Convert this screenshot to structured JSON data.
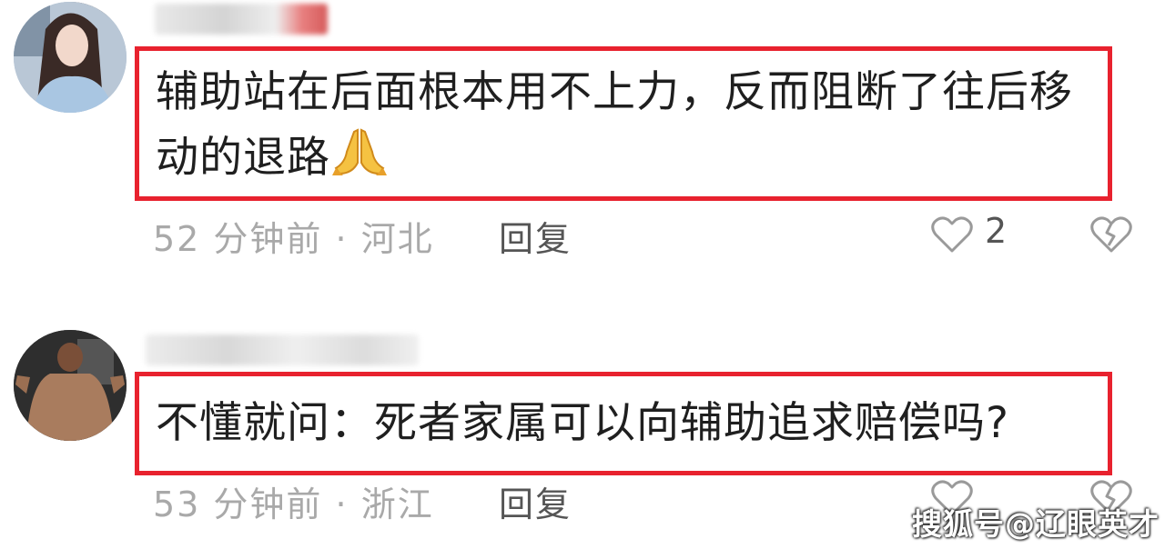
{
  "comments": [
    {
      "text": "辅助站在后面根本用不上力，反而阻断了往后移动的退路",
      "emoji": "🙏",
      "time": "52 分钟前",
      "separator": "·",
      "location": "河北",
      "reply_label": "回复",
      "likes": "2"
    },
    {
      "text": "不懂就问：死者家属可以向辅助追求赔偿吗?",
      "time": "53 分钟前",
      "separator": "·",
      "location": "浙江",
      "reply_label": "回复",
      "likes": ""
    }
  ],
  "watermark": "搜狐号@辽眼英才",
  "colors": {
    "highlight_border": "#e8222e",
    "meta_text": "#a9a9a9",
    "body_text": "#1f1f1f"
  },
  "icons": [
    "heart-outline-icon",
    "broken-heart-icon",
    "praying-hands-emoji"
  ]
}
